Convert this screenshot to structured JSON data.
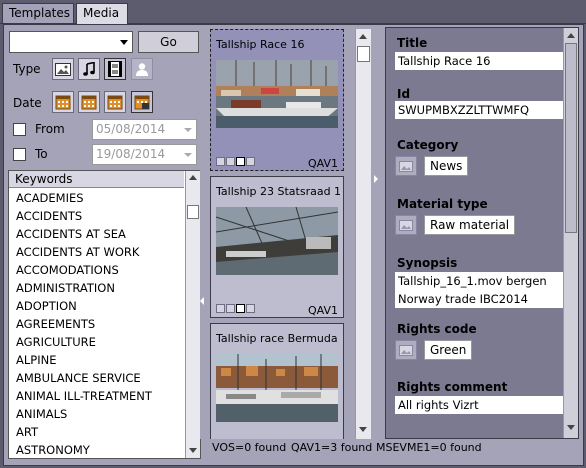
{
  "tabs": [
    {
      "label": "Templates"
    },
    {
      "label": "Media"
    }
  ],
  "search": {
    "value": "",
    "go_label": "Go"
  },
  "filters": {
    "type_label": "Type",
    "date_label": "Date",
    "from_label": "From",
    "from_value": "05/08/2014",
    "to_label": "To",
    "to_value": "19/08/2014"
  },
  "keywords": {
    "header": "Keywords",
    "items": [
      "ACADEMIES",
      "ACCIDENTS",
      "ACCIDENTS AT SEA",
      "ACCIDENTS AT WORK",
      "ACCOMODATIONS",
      "ADMINISTRATION",
      "ADOPTION",
      "AGREEMENTS",
      "AGRICULTURE",
      "ALPINE",
      "AMBULANCE SERVICE",
      "ANIMAL ILL-TREATMENT",
      "ANIMALS",
      "ART",
      "ASTRONOMY"
    ]
  },
  "media": [
    {
      "title": "Tallship Race 16",
      "channel": "QAV1"
    },
    {
      "title": "Tallship 23 Statsraad 1",
      "channel": "QAV1"
    },
    {
      "title": "Tallship race Bermuda S",
      "channel": ""
    }
  ],
  "status": {
    "vos": "VOS=0 found",
    "qav1": "QAV1=3 found",
    "msevme1": "MSEVME1=0 found"
  },
  "details": {
    "title_label": "Title",
    "title_value": "Tallship Race 16",
    "id_label": "Id",
    "id_value": "SWUPMBXZZLTTWMFQ",
    "category_label": "Category",
    "category_value": "News",
    "material_label": "Material type",
    "material_value": "Raw material",
    "synopsis_label": "Synopsis",
    "synopsis_line1": "Tallship_16_1.mov bergen",
    "synopsis_line2": "Norway trade IBC2014",
    "rights_code_label": "Rights code",
    "rights_code_value": "Green",
    "rights_comment_label": "Rights comment",
    "rights_comment_value": "All rights Vizrt"
  },
  "icons": {
    "image": "image-icon",
    "audio": "music-note-icon",
    "video": "film-icon",
    "person": "person-icon",
    "calendar": "calendar-icon"
  }
}
